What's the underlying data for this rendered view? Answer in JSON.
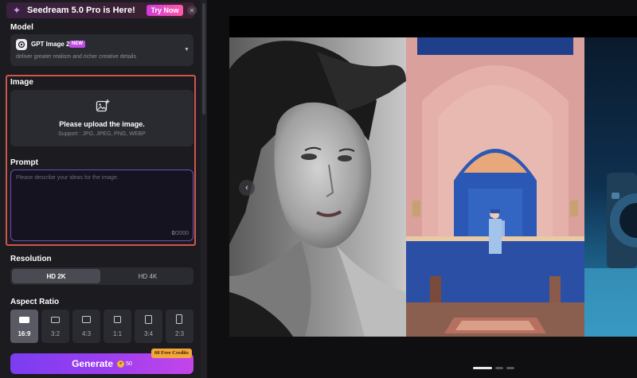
{
  "promo": {
    "text": "Seedream 5.0 Pro is Here!",
    "button": "Try Now",
    "close": "✕"
  },
  "model": {
    "section_label": "Model",
    "name": "GPT Image 2",
    "badge": "NEW",
    "description": "deliver greater realism and richer creative details"
  },
  "image": {
    "section_label": "Image",
    "upload_title": "Please upload the image.",
    "upload_support": "Support : JPG, JPEG, PNG, WEBP"
  },
  "prompt": {
    "section_label": "Prompt",
    "placeholder": "Please describe your ideas for the image.",
    "count": "0",
    "max": "/2000"
  },
  "resolution": {
    "section_label": "Resolution",
    "options": [
      "HD 2K",
      "HD 4K"
    ],
    "selected": "HD 2K"
  },
  "aspect_ratio": {
    "section_label": "Aspect Ratio",
    "options": [
      "16:9",
      "3:2",
      "4:3",
      "1:1",
      "3:4",
      "2:3"
    ],
    "selected": "16:9"
  },
  "generate": {
    "label": "Generate",
    "cost": "50",
    "credits_badge": "60 Free Credits"
  },
  "gallery": {
    "prev_icon": "‹",
    "images": [
      "woman-portrait-bw",
      "pink-hallway-doorman",
      "blue-camera"
    ],
    "active_dot": 1,
    "dot_count": 3
  },
  "colors": {
    "accent_start": "#7b3df0",
    "accent_end": "#c445e8",
    "highlight_frame": "#d0554a",
    "credits_badge": "#f3a73b"
  }
}
